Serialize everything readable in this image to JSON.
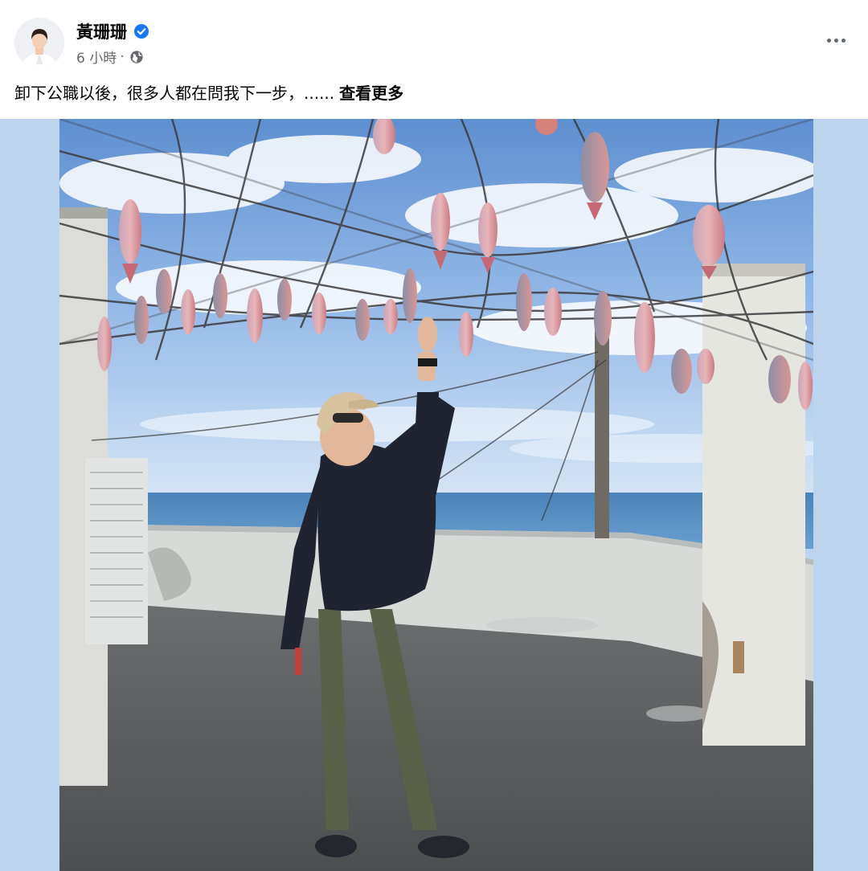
{
  "post": {
    "author_name": "黃珊珊",
    "timestamp": "6 小時",
    "separator": "·",
    "caption_text": "卸下公職以後，很多人都在問我下一步，......",
    "see_more_label": "查看更多"
  },
  "icons": {
    "verified": "verified-badge-icon",
    "audience": "globe-icon",
    "more": "more-options-icon"
  },
  "colors": {
    "verified_blue": "#1877f2",
    "meta_gray": "#65676b",
    "side_panel_blue": "#bcd4ee"
  }
}
